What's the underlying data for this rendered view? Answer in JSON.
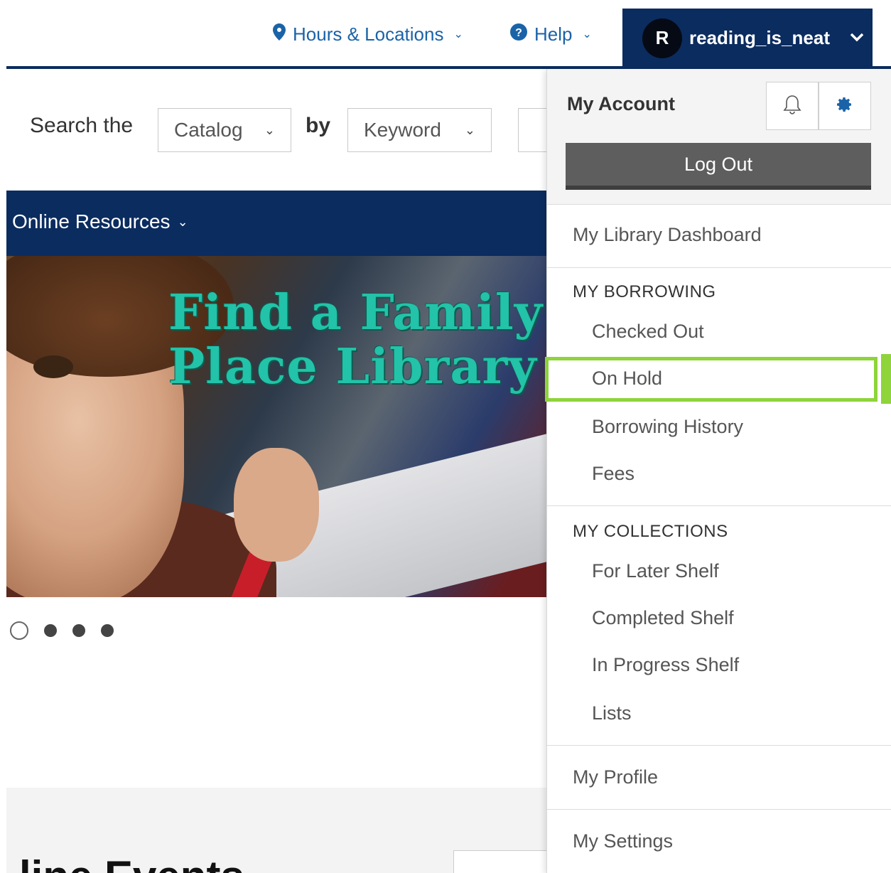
{
  "topbar": {
    "hours_label": "Hours & Locations",
    "help_label": "Help",
    "user": {
      "initial": "R",
      "name": "reading_is_neat"
    }
  },
  "search": {
    "label": "Search the",
    "scope_value": "Catalog",
    "by_label": "by",
    "field_value": "Keyword"
  },
  "nav": {
    "items": [
      {
        "label": "Online Resources"
      }
    ]
  },
  "hero": {
    "title_line1": "Find a Family",
    "title_line2": "Place Library",
    "dots": 4,
    "active_dot": 0
  },
  "lower": {
    "heading": "line Events"
  },
  "account_menu": {
    "title": "My Account",
    "logout_label": "Log Out",
    "dashboard": "My Library Dashboard",
    "borrowing_heading": "MY BORROWING",
    "borrowing_items": [
      "Checked Out",
      "On Hold",
      "Borrowing History",
      "Fees"
    ],
    "collections_heading": "MY COLLECTIONS",
    "collections_items": [
      "For Later Shelf",
      "Completed Shelf",
      "In Progress Shelf",
      "Lists"
    ],
    "profile": "My Profile",
    "settings": "My Settings",
    "highlighted_item": "On Hold",
    "highlight_color": "#8ed43a"
  },
  "colors": {
    "brand_navy": "#0b2c5f",
    "link_blue": "#1a63a8",
    "hero_title": "#22c3a8"
  }
}
